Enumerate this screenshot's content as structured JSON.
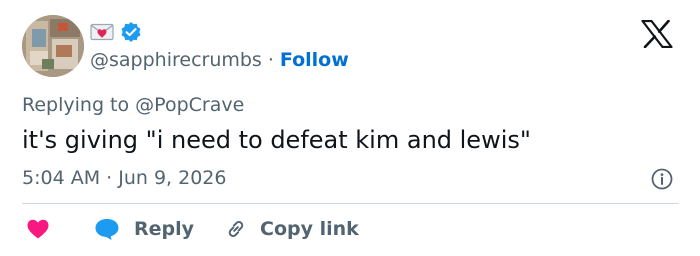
{
  "author": {
    "handle": "@sapphirecrumbs",
    "follow_label": "Follow",
    "verified_color": "#1d9bf0",
    "badges": [
      "love-letter-emoji-icon",
      "verified-badge-icon"
    ]
  },
  "reply_context": {
    "prefix": "Replying to",
    "mention": "@PopCrave"
  },
  "tweet": {
    "text": "it's giving \"i need to defeat kim and lewis\"",
    "timestamp": "5:04 AM · Jun 9, 2026"
  },
  "actions": {
    "like_icon": "heart-icon",
    "like_color": "#f91880",
    "reply_label": "Reply",
    "reply_icon_color": "#1d9bf0",
    "copy_label": "Copy link"
  },
  "colors": {
    "accent": "#006fd6",
    "muted": "#536471",
    "divider": "#cfd9de"
  }
}
